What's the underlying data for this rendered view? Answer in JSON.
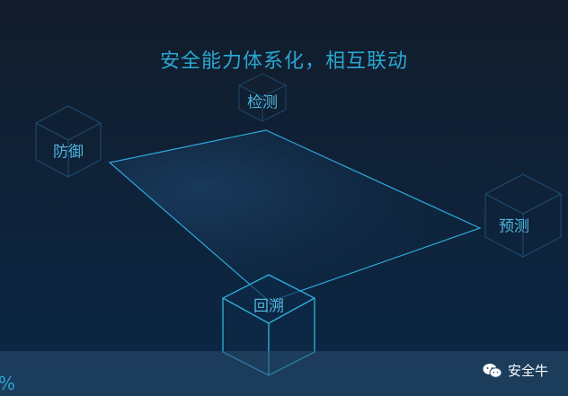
{
  "title": "安全能力体系化，相互联动",
  "nodes": {
    "detect": "检测",
    "defend": "防御",
    "predict": "预测",
    "retrace": "回溯"
  },
  "footer": {
    "left_text": "%",
    "brand_name": "安全牛",
    "brand_icon": "wechat-icon"
  },
  "colors": {
    "accent": "#2aa6d2",
    "line": "#2ea8d8"
  }
}
